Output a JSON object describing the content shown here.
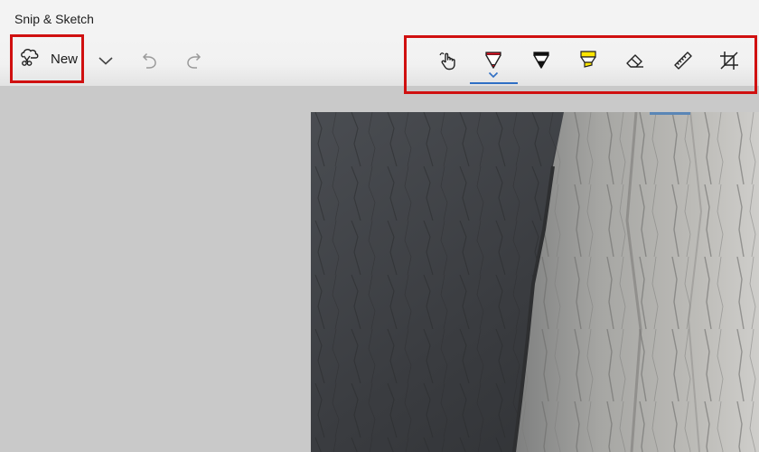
{
  "window": {
    "title": "Snip & Sketch"
  },
  "toolbar": {
    "new_label": "New",
    "icons": {
      "new": "snip-cloud-scissors-icon",
      "dropdown": "chevron-down-icon",
      "undo": "undo-icon",
      "redo": "redo-icon"
    }
  },
  "tools": [
    {
      "name": "touch-writing",
      "icon": "touch-writing-icon"
    },
    {
      "name": "ballpoint-pen",
      "icon": "ballpoint-pen-icon",
      "color": "#e81123",
      "active": true
    },
    {
      "name": "pencil",
      "icon": "pencil-icon",
      "color": "#000000"
    },
    {
      "name": "highlighter",
      "icon": "highlighter-icon",
      "color": "#ffe600"
    },
    {
      "name": "eraser",
      "icon": "eraser-icon"
    },
    {
      "name": "ruler",
      "icon": "ruler-icon"
    },
    {
      "name": "crop",
      "icon": "crop-icon"
    }
  ],
  "colors": {
    "highlight_box": "#d01010",
    "active_underline": "#2f6fc4",
    "canvas_background": "#c9c9c9"
  },
  "canvas": {
    "image": "granite-cliff-photo"
  }
}
